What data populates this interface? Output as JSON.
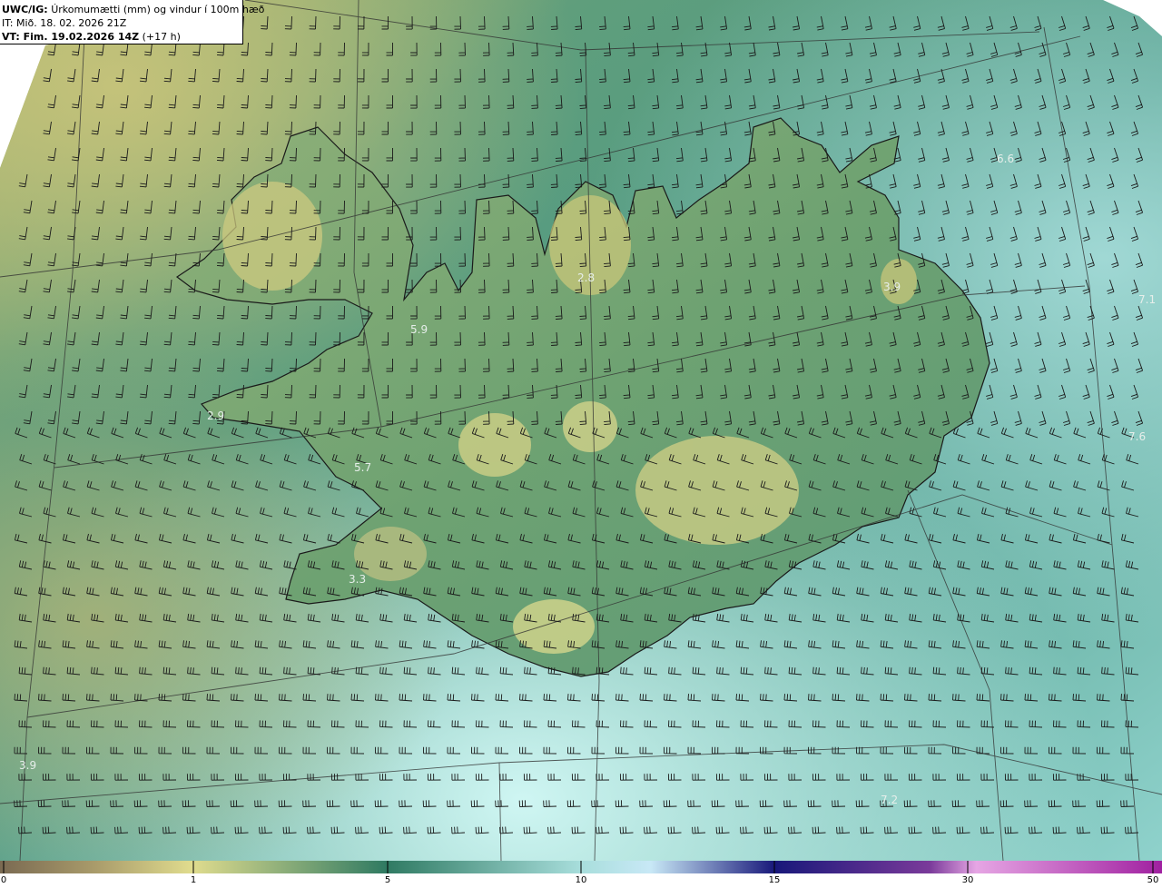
{
  "header": {
    "model": "UWC/IG:",
    "description": "Úrkomumætti (mm) og vindur í 100m hæð",
    "init_time": "IT: Mið. 18. 02. 2026 21Z",
    "valid_prefix": "VT: Fim. 19.02.2026 14Z",
    "valid_suffix": "(+17 h)"
  },
  "legend": {
    "ticks": [
      {
        "label": "0",
        "value": 0
      },
      {
        "label": "1",
        "value": 1
      },
      {
        "label": "5",
        "value": 5
      },
      {
        "label": "10",
        "value": 10
      },
      {
        "label": "15",
        "value": 15
      },
      {
        "label": "30",
        "value": 30
      },
      {
        "label": "50",
        "value": 50
      }
    ],
    "colors": [
      "#7a6a52",
      "#d8d58a",
      "#2f7a62",
      "#a8dedc",
      "#18187a",
      "#d27ad0",
      "#a020a0"
    ]
  },
  "colors": {
    "sea_dark": "#4f9e85",
    "sea_light": "#c6f0ee",
    "land_yellow": "#c9c77a",
    "land_green": "#3f8a6a",
    "coast": "#1a1a1a"
  },
  "value_labels": [
    {
      "text": "2.8"
    },
    {
      "text": "5.9"
    },
    {
      "text": "3.9"
    },
    {
      "text": "7.1"
    },
    {
      "text": "6.6"
    },
    {
      "text": "2.9"
    },
    {
      "text": "5.7"
    },
    {
      "text": "3.3"
    },
    {
      "text": "7.6"
    },
    {
      "text": "3.9"
    },
    {
      "text": "7.2"
    }
  ]
}
